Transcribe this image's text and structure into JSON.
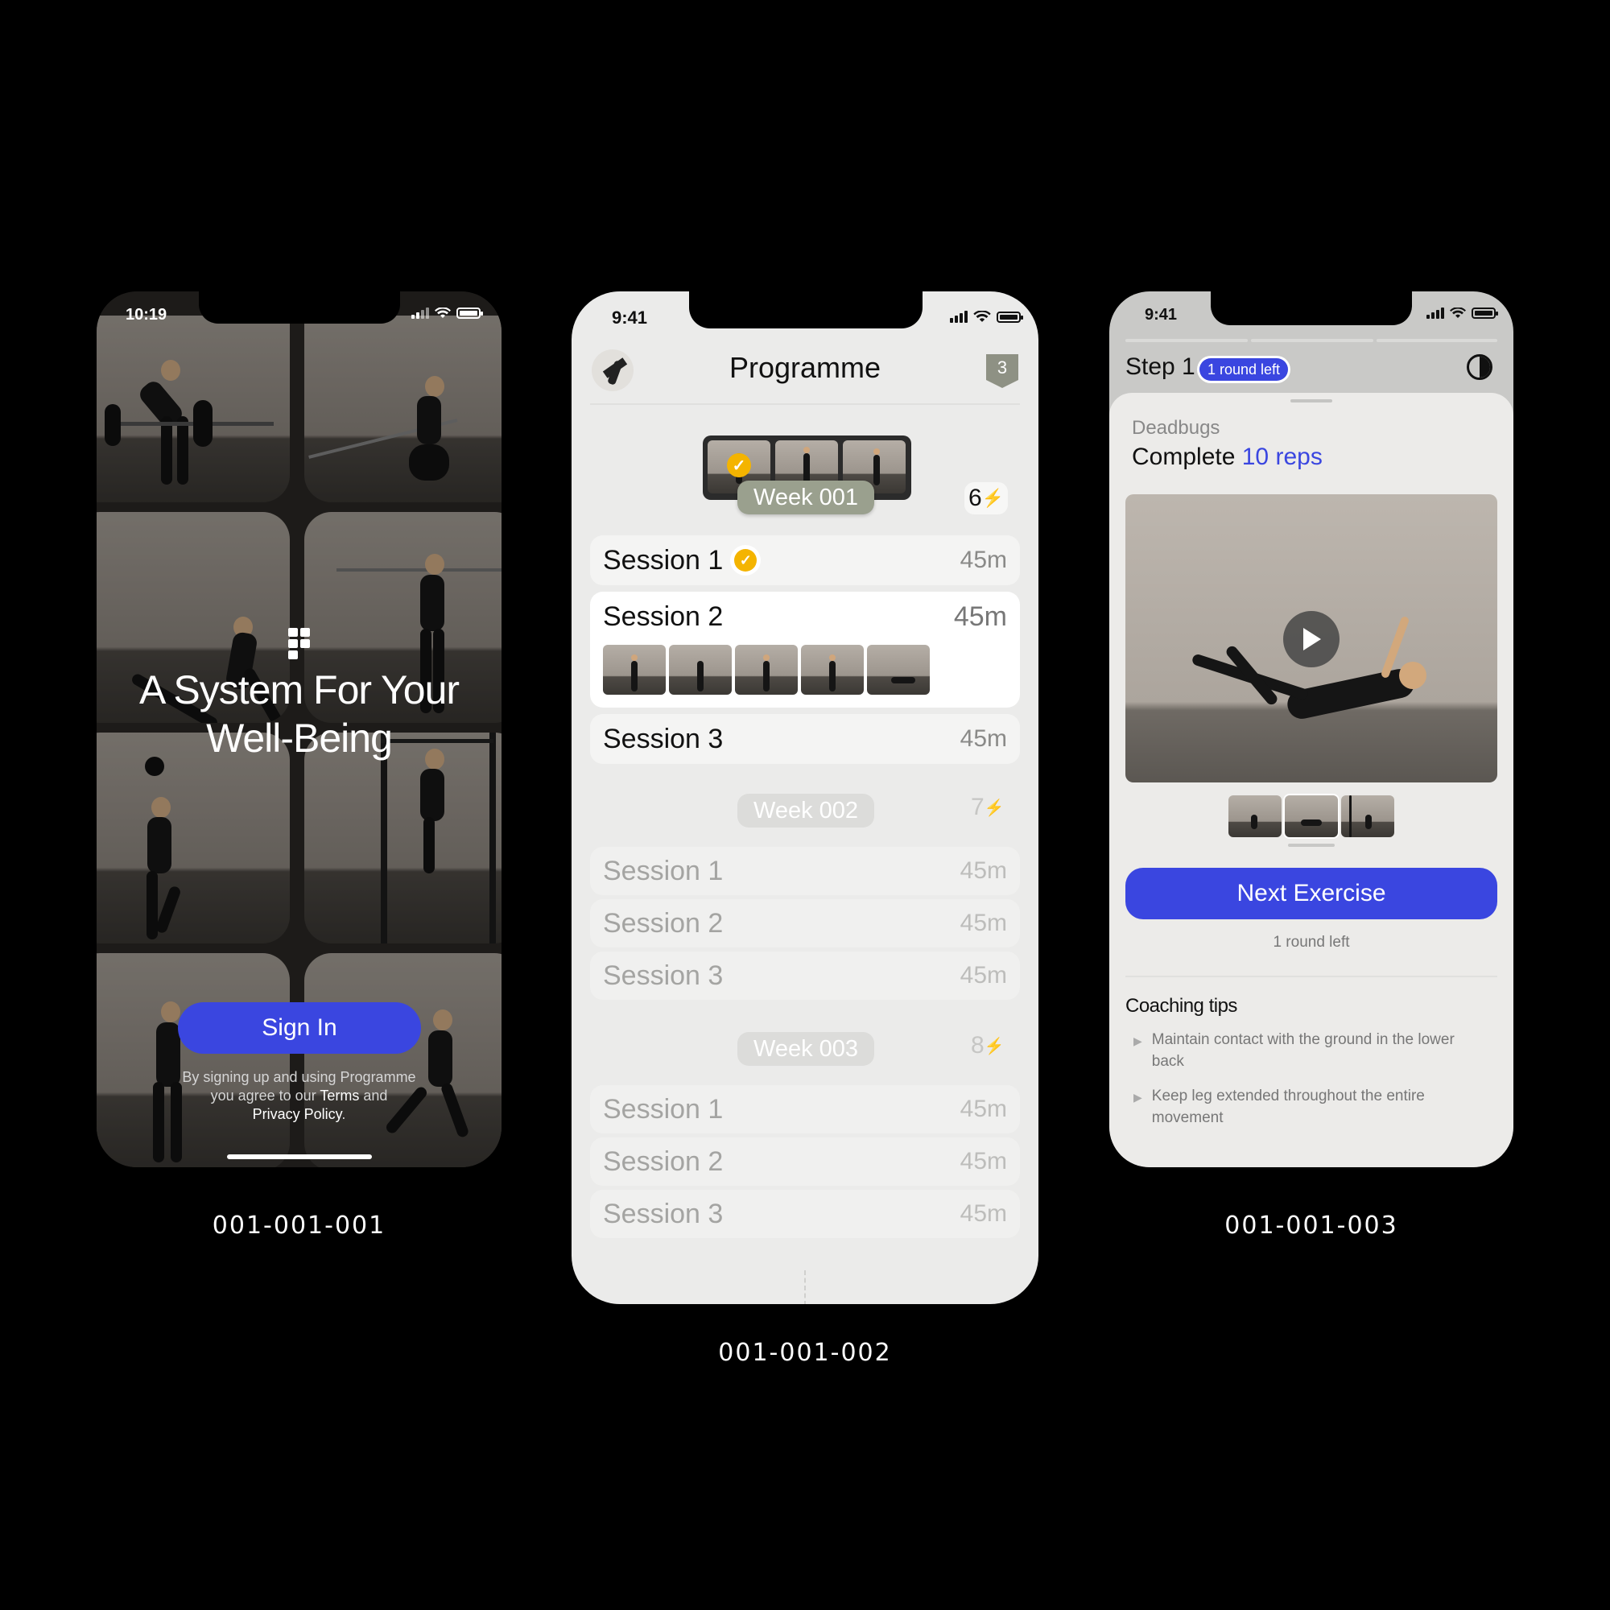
{
  "screens": [
    {
      "id_label": "001-001-001",
      "status_time": "10:19",
      "headline": [
        "A System For Your",
        "Well-Being"
      ],
      "signin_label": "Sign In",
      "legal": {
        "line1": "By signing up and using Programme",
        "line2_pre": "you agree to our ",
        "terms": "Terms",
        "line2_post": " and",
        "privacy": "Privacy Policy",
        "period": "."
      }
    },
    {
      "id_label": "001-001-002",
      "status_time": "9:41",
      "title": "Programme",
      "badge_count": "3",
      "weeks": [
        {
          "label": "Week 001",
          "energy": "6",
          "sessions": [
            {
              "name": "Session 1",
              "duration": "45m",
              "completed": true
            },
            {
              "name": "Session 2",
              "duration": "45m",
              "expanded": true
            },
            {
              "name": "Session 3",
              "duration": "45m"
            }
          ]
        },
        {
          "label": "Week 002",
          "energy": "7",
          "sessions": [
            {
              "name": "Session 1",
              "duration": "45m"
            },
            {
              "name": "Session 2",
              "duration": "45m"
            },
            {
              "name": "Session 3",
              "duration": "45m"
            }
          ]
        },
        {
          "label": "Week 003",
          "energy": "8",
          "sessions": [
            {
              "name": "Session 1",
              "duration": "45m"
            },
            {
              "name": "Session 2",
              "duration": "45m"
            },
            {
              "name": "Session 3",
              "duration": "45m"
            }
          ]
        }
      ],
      "bolt_icon": "lightning-icon"
    },
    {
      "id_label": "001-001-003",
      "status_time": "9:41",
      "step": "Step 1",
      "step_badge": "1 round left",
      "exercise_name": "Deadbugs",
      "instruction_pre": "Complete",
      "instruction_reps": "10 reps",
      "next_label": "Next Exercise",
      "rounds_left": "1 round left",
      "tips_title": "Coaching tips",
      "tips": [
        "Maintain contact with the ground in the lower back",
        "Keep leg extended throughout the entire movement"
      ]
    }
  ],
  "colors": {
    "accent": "#3a46e0",
    "gold": "#f4b400",
    "background": "#000000"
  }
}
